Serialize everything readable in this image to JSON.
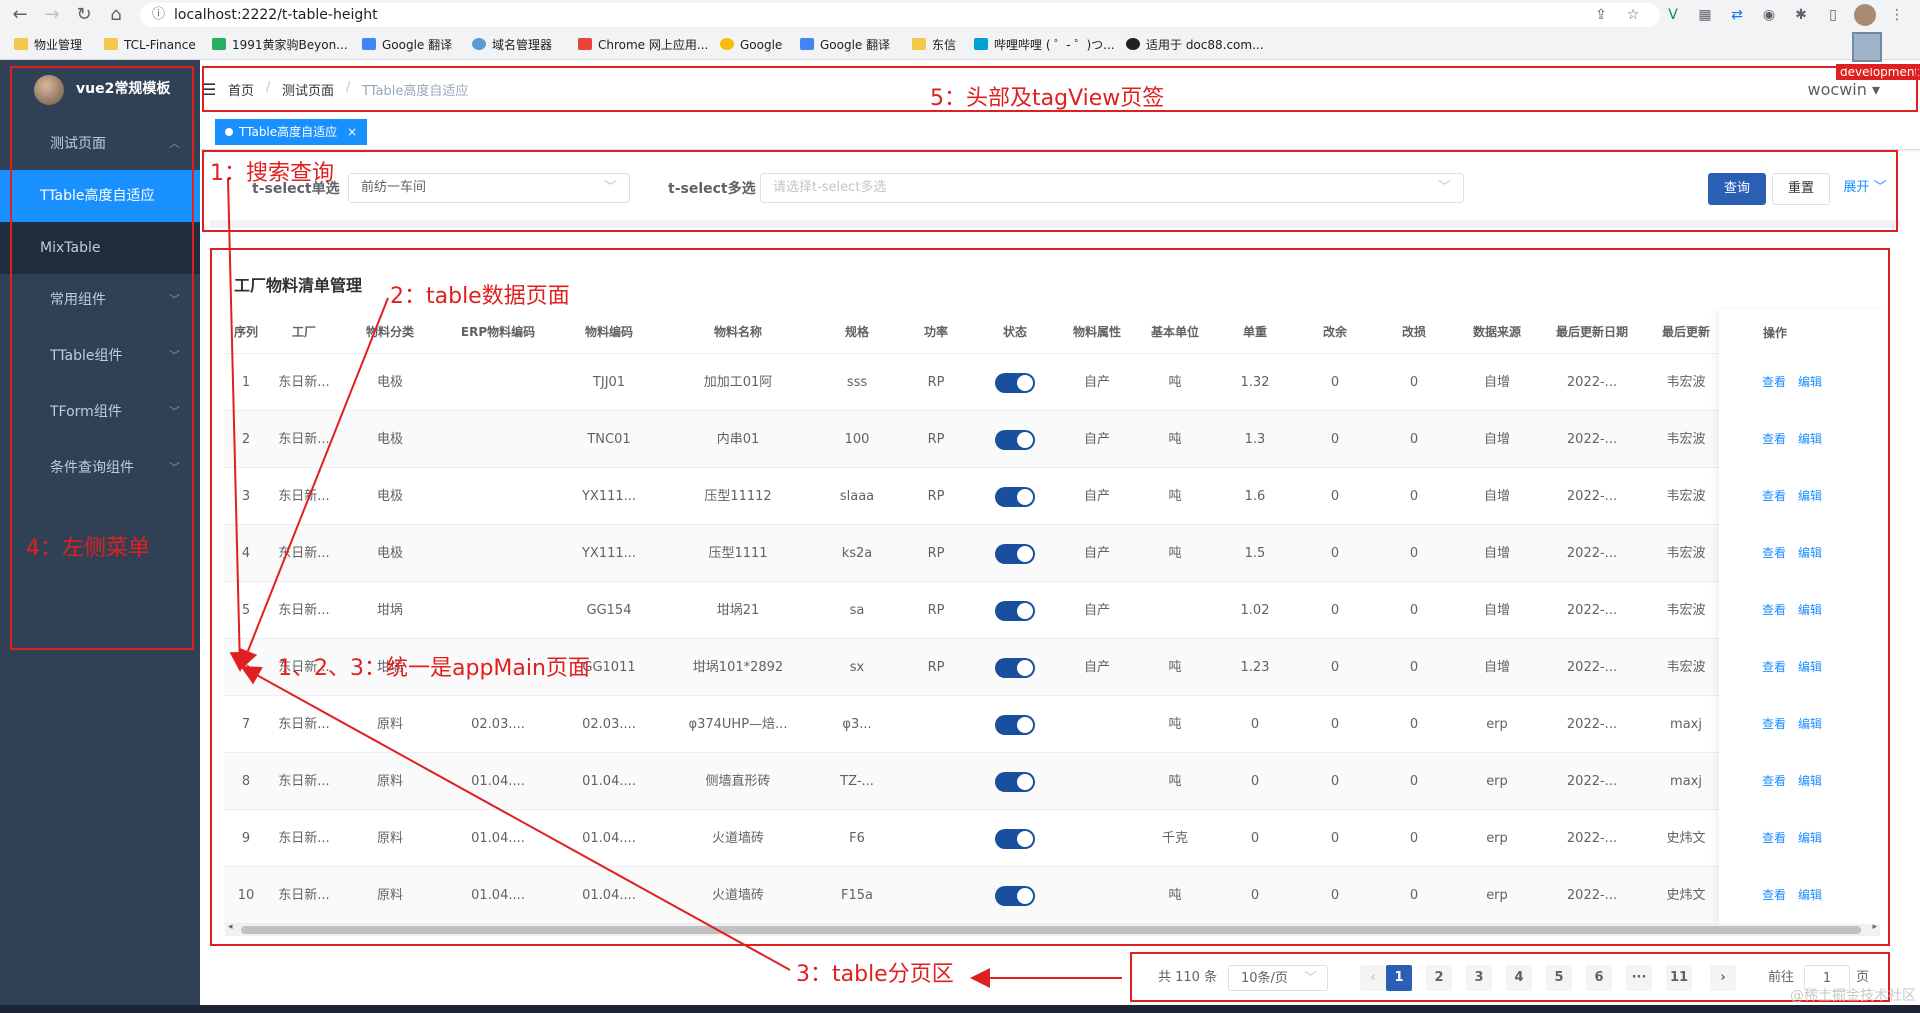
{
  "browser": {
    "url": "localhost:2222/t-table-height",
    "bookmarks": [
      "物业管理",
      "TCL-Finance",
      "1991黄家驹Beyon...",
      "Google 翻译",
      "域名管理器",
      "Chrome 网上应用...",
      "Google",
      "Google 翻译",
      "东信",
      "哔哩哔哩 ( ゜- ゜)つ...",
      "适用于 doc88.com..."
    ]
  },
  "sidebar": {
    "logo": "vue2常规模板",
    "items": [
      {
        "label": "测试页面"
      },
      {
        "label": "TTable高度自适应"
      },
      {
        "label": "MixTable"
      },
      {
        "label": "常用组件"
      },
      {
        "label": "TTable组件"
      },
      {
        "label": "TForm组件"
      },
      {
        "label": "条件查询组件"
      }
    ]
  },
  "header": {
    "breadcrumb": [
      "首页",
      "测试页面",
      "TTable高度自适应"
    ],
    "separator": "/",
    "user": "wocwin",
    "tag": "TTable高度自适应",
    "env_badge": "development"
  },
  "search": {
    "label1": "t-select单选",
    "value1": "前纺一车间",
    "label2": "t-select多选",
    "placeholder2": "请选择t-select多选",
    "query": "查询",
    "reset": "重置",
    "expand": "展开"
  },
  "table": {
    "title": "工厂物料清单管理",
    "columns": [
      "序列",
      "工厂",
      "物料分类",
      "ERP物料编码",
      "物料编码",
      "物料名称",
      "规格",
      "功率",
      "状态",
      "物料属性",
      "基本单位",
      "单重",
      "改余",
      "改损",
      "数据来源",
      "最后更新日期",
      "最后更新"
    ],
    "op_header": "操作",
    "op_view": "查看",
    "op_edit": "编辑",
    "rows": [
      [
        "1",
        "东日新...",
        "电极",
        "",
        "TJJ01",
        "加加工01阿",
        "sss",
        "RP",
        "",
        "自产",
        "吨",
        "1.32",
        "0",
        "0",
        "自增",
        "2022-...",
        "韦宏波"
      ],
      [
        "2",
        "东日新...",
        "电极",
        "",
        "TNC01",
        "内串01",
        "100",
        "RP",
        "",
        "自产",
        "吨",
        "1.3",
        "0",
        "0",
        "自增",
        "2022-...",
        "韦宏波"
      ],
      [
        "3",
        "东日新...",
        "电极",
        "",
        "YX111...",
        "压型11112",
        "slaaa",
        "RP",
        "",
        "自产",
        "吨",
        "1.6",
        "0",
        "0",
        "自增",
        "2022-...",
        "韦宏波"
      ],
      [
        "4",
        "东日新...",
        "电极",
        "",
        "YX111...",
        "压型1111",
        "ks2a",
        "RP",
        "",
        "自产",
        "吨",
        "1.5",
        "0",
        "0",
        "自增",
        "2022-...",
        "韦宏波"
      ],
      [
        "5",
        "东日新...",
        "坩埚",
        "",
        "GG154",
        "坩埚21",
        "sa",
        "RP",
        "",
        "自产",
        "",
        "1.02",
        "0",
        "0",
        "自增",
        "2022-...",
        "韦宏波"
      ],
      [
        "6",
        "东日新...",
        "坩埚",
        "",
        "GG1011",
        "坩埚101*2892",
        "sx",
        "RP",
        "",
        "自产",
        "吨",
        "1.23",
        "0",
        "0",
        "自增",
        "2022-...",
        "韦宏波"
      ],
      [
        "7",
        "东日新...",
        "原料",
        "02.03....",
        "02.03....",
        "φ374UHP—焙...",
        "φ3...",
        "",
        "",
        "",
        "吨",
        "0",
        "0",
        "0",
        "erp",
        "2022-...",
        "maxj"
      ],
      [
        "8",
        "东日新...",
        "原料",
        "01.04....",
        "01.04....",
        "侧墙直形砖",
        "TZ-...",
        "",
        "",
        "",
        "吨",
        "0",
        "0",
        "0",
        "erp",
        "2022-...",
        "maxj"
      ],
      [
        "9",
        "东日新...",
        "原料",
        "01.04....",
        "01.04....",
        "火道墙砖",
        "F6",
        "",
        "",
        "",
        "千克",
        "0",
        "0",
        "0",
        "erp",
        "2022-...",
        "史炜文"
      ],
      [
        "10",
        "东日新...",
        "原料",
        "01.04....",
        "01.04....",
        "火道墙砖",
        "F15a",
        "",
        "",
        "",
        "吨",
        "0",
        "0",
        "0",
        "erp",
        "2022-...",
        "史炜文"
      ]
    ]
  },
  "pager": {
    "total": "共 110 条",
    "size": "10条/页",
    "pages": [
      "1",
      "2",
      "3",
      "4",
      "5",
      "6",
      "···",
      "11"
    ],
    "goto": "前往",
    "goto_value": "1",
    "page_unit": "页"
  },
  "annotations": {
    "a1": "1：搜索查询",
    "a2": "2：table数据页面",
    "a3": "3：table分页区",
    "a4": "4：左侧菜单",
    "a5": "5：头部及tagView页签",
    "a6": "1、2、3：统一是appMain页面"
  },
  "watermark": "@稀土掘金技术社区",
  "colors": {
    "sidebar": "#304156",
    "active": "#1890ff",
    "annotation": "#e02020",
    "primary": "#2b5fb3"
  }
}
